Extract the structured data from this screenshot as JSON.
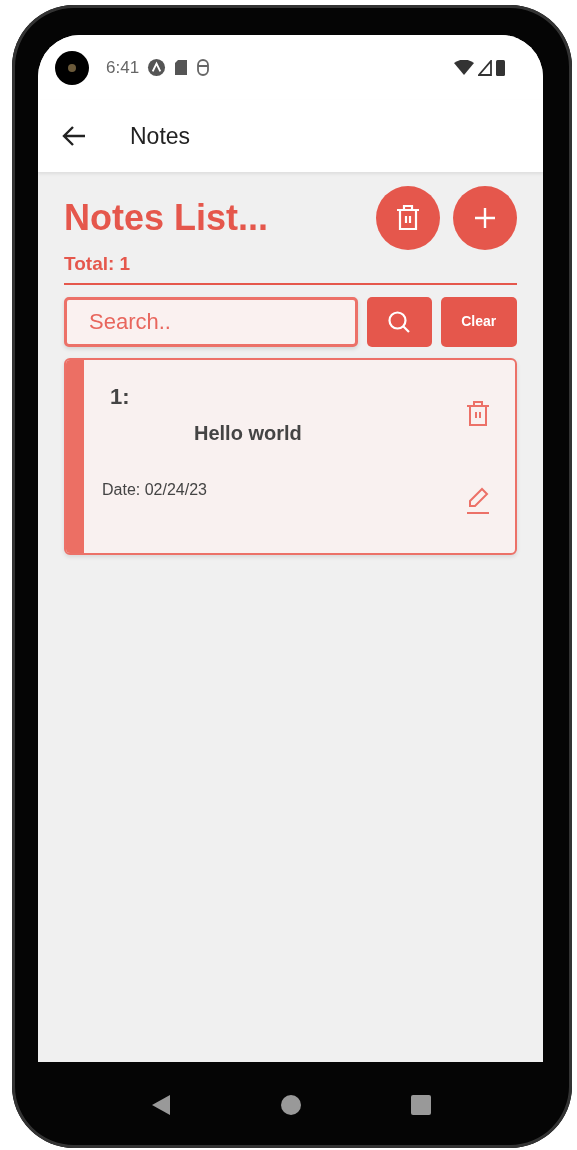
{
  "status_bar": {
    "time": "6:41"
  },
  "app_bar": {
    "title": "Notes"
  },
  "header": {
    "title": "Notes List...",
    "total": "Total: 1"
  },
  "search": {
    "placeholder": "Search..",
    "clear_label": "Clear"
  },
  "notes": [
    {
      "number": "1:",
      "title": "Hello world",
      "date": "Date: 02/24/23"
    }
  ]
}
